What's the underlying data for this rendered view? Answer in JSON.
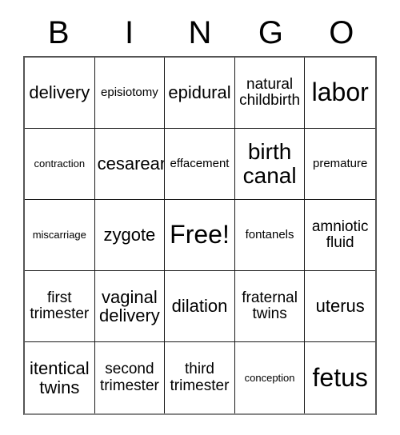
{
  "card": {
    "header_letters": [
      "B",
      "I",
      "N",
      "G",
      "O"
    ],
    "rows": [
      [
        {
          "text": "delivery",
          "size": "lg"
        },
        {
          "text": "episiotomy",
          "size": "sm"
        },
        {
          "text": "epidural",
          "size": "lg"
        },
        {
          "text": "natural childbirth",
          "size": "md"
        },
        {
          "text": "labor",
          "size": "xxl"
        }
      ],
      [
        {
          "text": "contraction",
          "size": "xs"
        },
        {
          "text": "cesarean",
          "size": "lg"
        },
        {
          "text": "effacement",
          "size": "sm"
        },
        {
          "text": "birth canal",
          "size": "xl"
        },
        {
          "text": "premature",
          "size": "sm"
        }
      ],
      [
        {
          "text": "miscarriage",
          "size": "xs"
        },
        {
          "text": "zygote",
          "size": "lg"
        },
        {
          "text": "Free!",
          "size": "xxl"
        },
        {
          "text": "fontanels",
          "size": "sm"
        },
        {
          "text": "amniotic fluid",
          "size": "md"
        }
      ],
      [
        {
          "text": "first trimester",
          "size": "md"
        },
        {
          "text": "vaginal delivery",
          "size": "lg"
        },
        {
          "text": "dilation",
          "size": "lg"
        },
        {
          "text": "fraternal twins",
          "size": "md"
        },
        {
          "text": "uterus",
          "size": "lg"
        }
      ],
      [
        {
          "text": "itentical twins",
          "size": "lg"
        },
        {
          "text": "second trimester",
          "size": "md"
        },
        {
          "text": "third trimester",
          "size": "md"
        },
        {
          "text": "conception",
          "size": "xs"
        },
        {
          "text": "fetus",
          "size": "xxl"
        }
      ]
    ]
  },
  "colors": {
    "background": "#ffffff",
    "text": "#000000",
    "cell_border": "#1a1a1a",
    "outer_border": "#555555"
  }
}
